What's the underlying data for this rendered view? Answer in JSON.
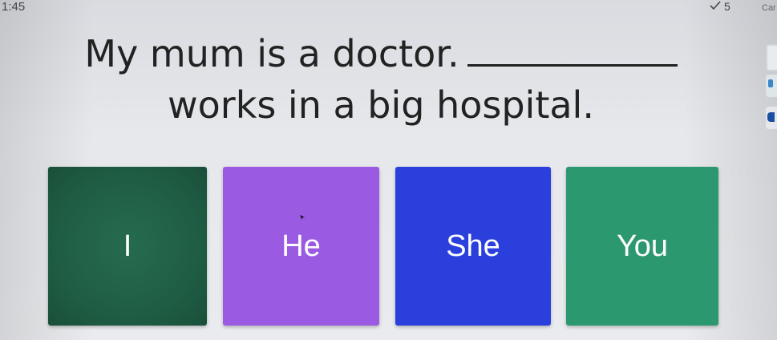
{
  "status": {
    "timer": "1:45",
    "score": "5",
    "corner_label": "Car"
  },
  "question": {
    "line1": "My mum is a doctor.",
    "line2": "works in a big hospital."
  },
  "answers": [
    {
      "label": "I",
      "color": "#1f5e45"
    },
    {
      "label": "He",
      "color": "#9b5ae2"
    },
    {
      "label": "She",
      "color": "#2a3fdc"
    },
    {
      "label": "You",
      "color": "#2c9870"
    }
  ],
  "icons": {
    "score": "check-icon",
    "cursor": "pointer-cursor-icon"
  }
}
